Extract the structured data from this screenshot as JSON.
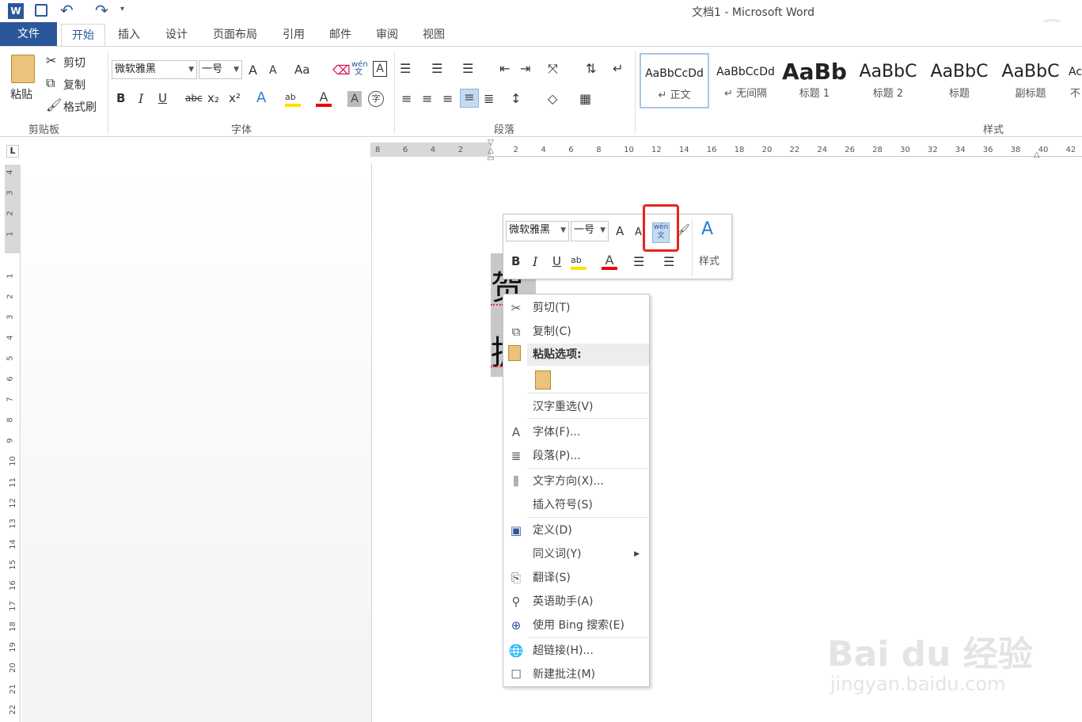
{
  "window": {
    "title": "文档1 - Microsoft Word"
  },
  "quick_access": {
    "word_icon": "W",
    "save_icon": "save-icon",
    "undo_icon": "↶",
    "redo_icon": "↷",
    "customize_icon": "▾"
  },
  "tabs": [
    "文件",
    "开始",
    "插入",
    "设计",
    "页面布局",
    "引用",
    "邮件",
    "审阅",
    "视图"
  ],
  "ribbon": {
    "clipboard": {
      "paste": "粘贴",
      "cut": "剪切",
      "copy": "复制",
      "format_painter": "格式刷",
      "label": "剪贴板"
    },
    "font": {
      "name": "微软雅黑",
      "size": "一号",
      "label": "字体",
      "bold": "B",
      "italic": "I",
      "underline": "U",
      "strike": "abc",
      "sub": "x₂",
      "sup": "x²",
      "case": "Aa",
      "phonetic": "wén文",
      "grow": "A",
      "shrink": "A"
    },
    "paragraph": {
      "label": "段落"
    },
    "styles": {
      "label": "样式",
      "items": [
        {
          "sample": "AaBbCcDd",
          "name": "↵ 正文"
        },
        {
          "sample": "AaBbCcDd",
          "name": "↵ 无间隔"
        },
        {
          "sample": "AaBb",
          "name": "标题 1"
        },
        {
          "sample": "AaBbC",
          "name": "标题 2"
        },
        {
          "sample": "AaBbC",
          "name": "标题"
        },
        {
          "sample": "AaBbC",
          "name": "副标题"
        },
        {
          "sample": "Ac",
          "name": "不"
        }
      ]
    }
  },
  "ruler_h": [
    "8",
    "6",
    "4",
    "2",
    "",
    "2",
    "4",
    "6",
    "8",
    "10",
    "12",
    "14",
    "16",
    "18",
    "20",
    "22",
    "24",
    "26",
    "28",
    "30",
    "32",
    "34",
    "36",
    "38",
    "40",
    "42"
  ],
  "ruler_v": [
    "4",
    "3",
    "2",
    "1",
    "",
    "1",
    "2",
    "3",
    "4",
    "5",
    "6",
    "7",
    "8",
    "9",
    "10",
    "11",
    "12",
    "13",
    "14",
    "15",
    "16",
    "17",
    "18",
    "19",
    "20",
    "21",
    "22"
  ],
  "document": {
    "chars": [
      "贺",
      "拥"
    ]
  },
  "minibar": {
    "font": "微软雅黑",
    "size": "一号",
    "styles_label": "样式",
    "bold": "B",
    "italic": "I",
    "underline": "U"
  },
  "context_menu": [
    {
      "label": "剪切(T)"
    },
    {
      "label": "复制(C)"
    },
    {
      "label": "粘贴选项:"
    },
    {
      "label": "汉字重选(V)"
    },
    {
      "label": "字体(F)..."
    },
    {
      "label": "段落(P)..."
    },
    {
      "label": "文字方向(X)..."
    },
    {
      "label": "插入符号(S)"
    },
    {
      "label": "定义(D)"
    },
    {
      "label": "同义词(Y)"
    },
    {
      "label": "翻译(S)"
    },
    {
      "label": "英语助手(A)"
    },
    {
      "label": "使用 Bing 搜索(E)"
    },
    {
      "label": "超链接(H)..."
    },
    {
      "label": "新建批注(M)"
    }
  ],
  "watermark": {
    "brand": "Bai du 经验",
    "url": "jingyan.baidu.com"
  }
}
